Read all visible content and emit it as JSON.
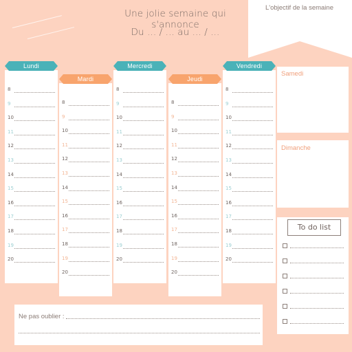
{
  "header": {
    "title_line1": "Une jolie semaine qui s'annonce",
    "title_line2": "Du ... / ... au ... / ..."
  },
  "objective": {
    "label": "L'objectif de la semaine"
  },
  "days": [
    {
      "name": "Lundi",
      "color": "teal",
      "hours": [
        "8",
        "9",
        "10",
        "11",
        "12",
        "13",
        "14",
        "15",
        "16",
        "17",
        "18",
        "19",
        "20"
      ]
    },
    {
      "name": "Mardi",
      "color": "orange",
      "hours": [
        "8",
        "9",
        "10",
        "11",
        "12",
        "13",
        "14",
        "15",
        "16",
        "17",
        "18",
        "19",
        "20"
      ]
    },
    {
      "name": "Mercredi",
      "color": "teal",
      "hours": [
        "8",
        "9",
        "10",
        "11",
        "12",
        "13",
        "14",
        "15",
        "16",
        "17",
        "18",
        "19",
        "20"
      ]
    },
    {
      "name": "Jeudi",
      "color": "orange",
      "hours": [
        "8",
        "9",
        "10",
        "11",
        "12",
        "13",
        "14",
        "15",
        "16",
        "17",
        "18",
        "19",
        "20"
      ]
    },
    {
      "name": "Vendredi",
      "color": "teal",
      "hours": [
        "8",
        "9",
        "10",
        "11",
        "12",
        "13",
        "14",
        "15",
        "16",
        "17",
        "18",
        "19",
        "20"
      ]
    }
  ],
  "weekend": {
    "saturday": "Samedi",
    "sunday": "Dimanche"
  },
  "todo": {
    "title": "To do list",
    "item_count": 6
  },
  "reminder": {
    "label": "Ne pas oublier :"
  },
  "colors": {
    "background": "#fdd3c0",
    "teal": "#4ab2b8",
    "orange": "#f8a46d",
    "card": "#ffffff"
  }
}
